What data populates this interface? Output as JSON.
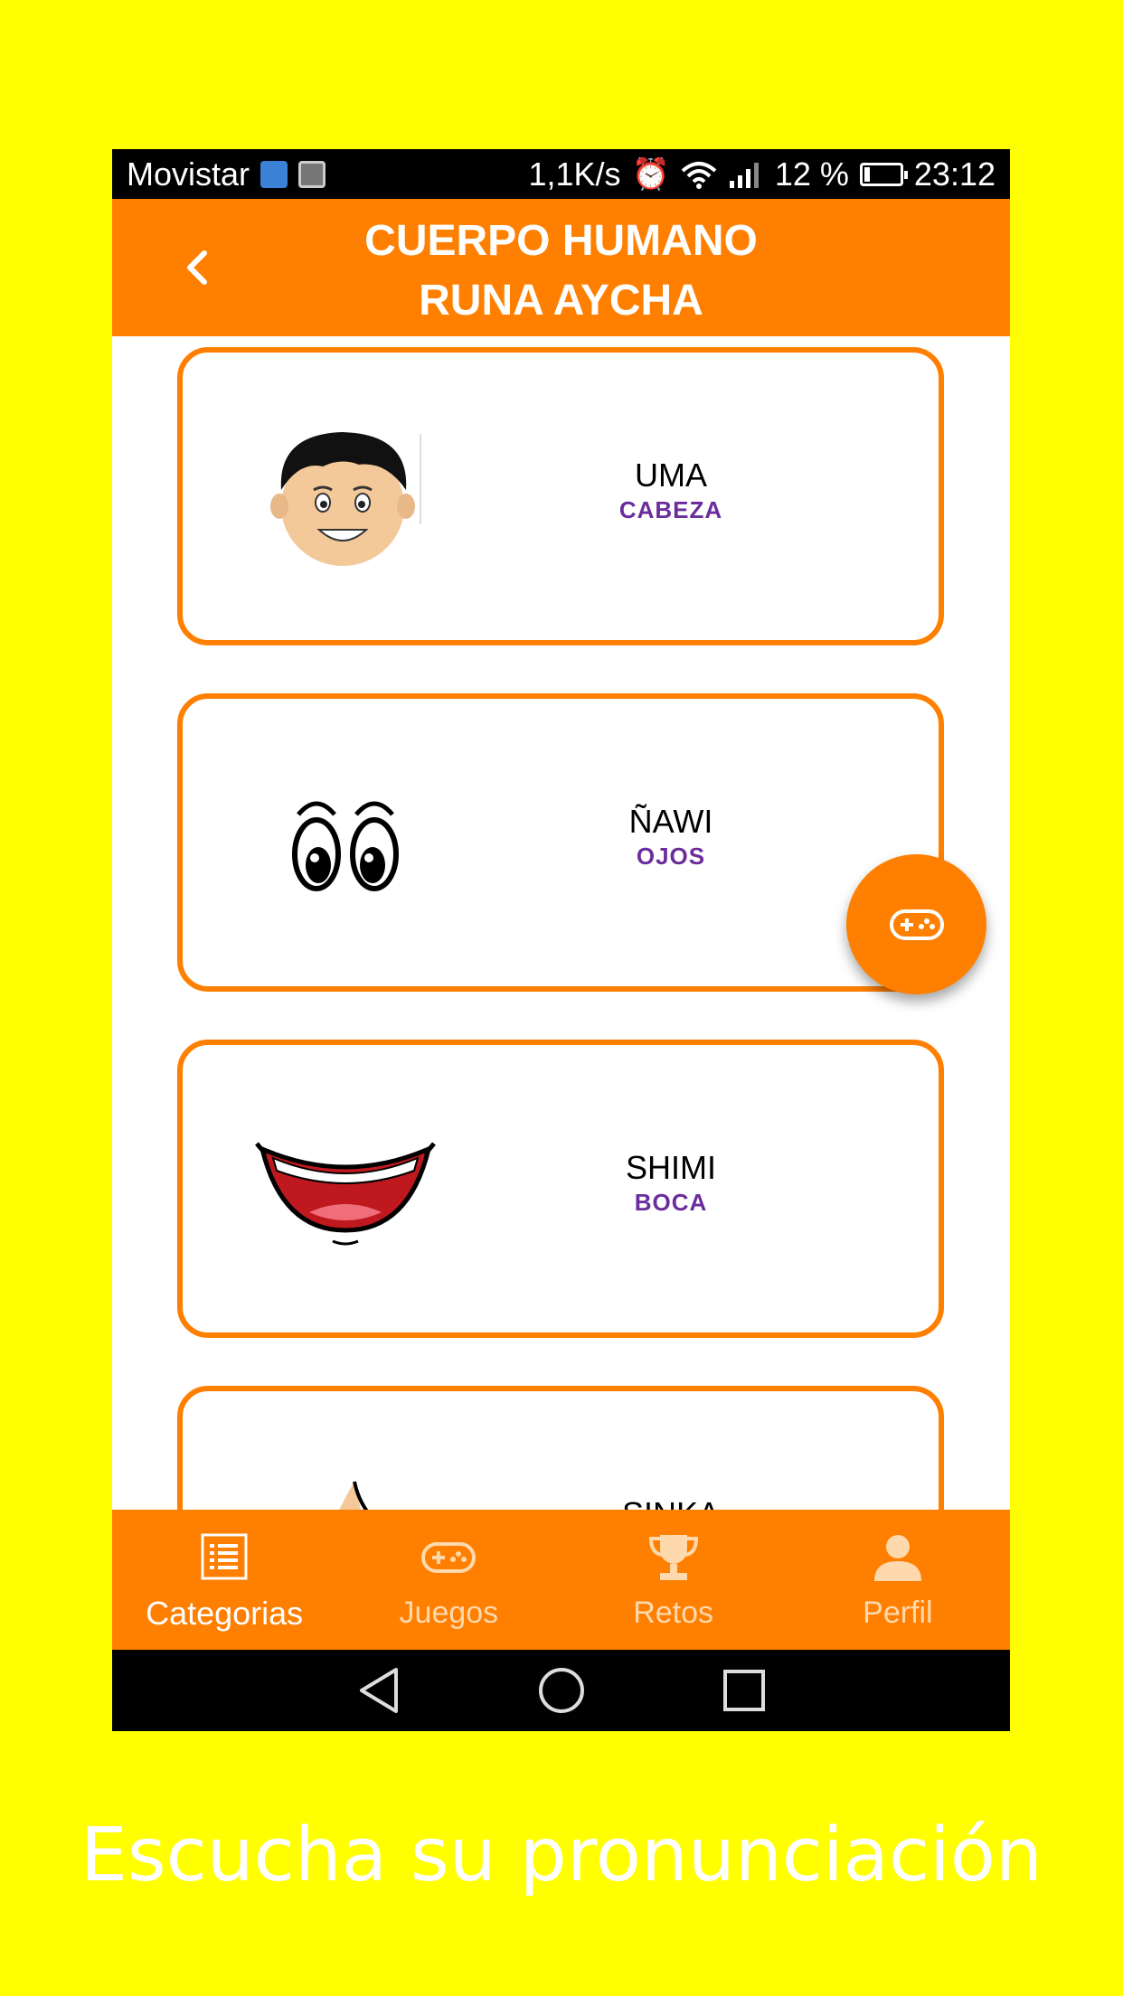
{
  "status_bar": {
    "carrier": "Movistar",
    "speed": "1,1K/s",
    "battery_percent": "12 %",
    "time": "23:12"
  },
  "header": {
    "title_line1": "CUERPO HUMANO",
    "title_line2": "RUNA AYCHA",
    "back_icon": "chevron-left-icon"
  },
  "items": [
    {
      "word": "UMA",
      "translation": "CABEZA",
      "image": "head-illustration"
    },
    {
      "word": "ÑAWI",
      "translation": "OJOS",
      "image": "eyes-illustration"
    },
    {
      "word": "SHIMI",
      "translation": "BOCA",
      "image": "mouth-illustration"
    },
    {
      "word": "SINKA",
      "translation": "",
      "image": "nose-illustration"
    }
  ],
  "fab": {
    "icon": "gamepad-icon"
  },
  "bottom_nav": [
    {
      "label": "Categorias",
      "icon": "list-icon",
      "active": true
    },
    {
      "label": "Juegos",
      "icon": "gamepad-icon",
      "active": false
    },
    {
      "label": "Retos",
      "icon": "trophy-icon",
      "active": false
    },
    {
      "label": "Perfil",
      "icon": "person-icon",
      "active": false
    }
  ],
  "caption": "Escucha su pronunciación",
  "colors": {
    "background": "#ffff00",
    "accent": "#ff7f00",
    "translation": "#6a2d9b"
  }
}
